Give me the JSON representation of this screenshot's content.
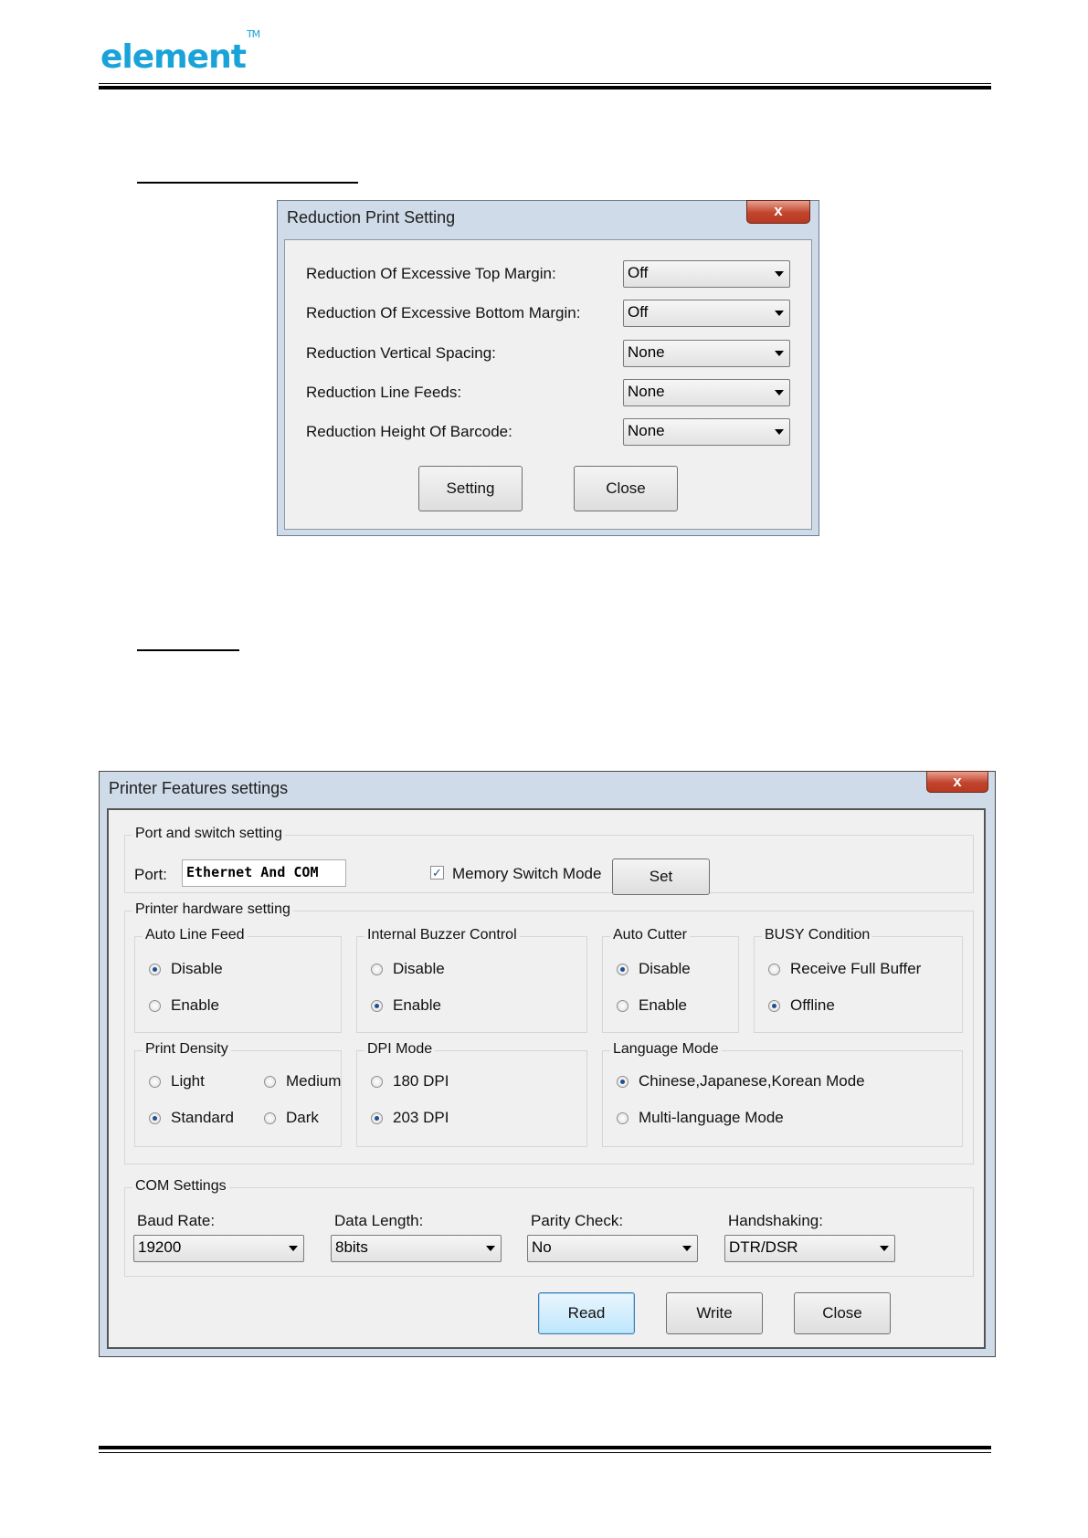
{
  "header": {
    "logo_text": "element",
    "logo_tm": "TM"
  },
  "reduction_dialog": {
    "title": "Reduction Print Setting",
    "close_glyph": "x",
    "rows": [
      {
        "label": "Reduction Of Excessive Top Margin:",
        "value": "Off"
      },
      {
        "label": "Reduction Of Excessive Bottom Margin:",
        "value": "Off"
      },
      {
        "label": "Reduction Vertical Spacing:",
        "value": "None"
      },
      {
        "label": "Reduction Line Feeds:",
        "value": "None"
      },
      {
        "label": "Reduction Height Of Barcode:",
        "value": "None"
      }
    ],
    "setting_button": "Setting",
    "close_button": "Close"
  },
  "features_dialog": {
    "title": "Printer Features settings",
    "close_glyph": "x",
    "port_group": {
      "label": "Port and switch setting",
      "port_label": "Port:",
      "port_value": "Ethernet And COM",
      "memory_switch_label": "Memory Switch Mode",
      "memory_switch_checked": true,
      "check_glyph": "✓",
      "set_button": "Set"
    },
    "hardware_group": {
      "label": "Printer hardware setting",
      "auto_line_feed": {
        "label": "Auto Line Feed",
        "options": [
          "Disable",
          "Enable"
        ],
        "selected": "Disable"
      },
      "buzzer": {
        "label": "Internal Buzzer Control",
        "options": [
          "Disable",
          "Enable"
        ],
        "selected": "Enable"
      },
      "auto_cutter": {
        "label": "Auto Cutter",
        "options": [
          "Disable",
          "Enable"
        ],
        "selected": "Disable"
      },
      "busy": {
        "label": "BUSY Condition",
        "options": [
          "Receive Full Buffer",
          "Offline"
        ],
        "selected": "Offline"
      },
      "density": {
        "label": "Print Density",
        "options": [
          "Light",
          "Medium",
          "Standard",
          "Dark"
        ],
        "selected": "Standard"
      },
      "dpi": {
        "label": "DPI Mode",
        "options": [
          "180 DPI",
          "203 DPI"
        ],
        "selected": "203 DPI"
      },
      "language": {
        "label": "Language Mode",
        "options": [
          "Chinese,Japanese,Korean Mode",
          "Multi-language Mode"
        ],
        "selected": "Chinese,Japanese,Korean Mode"
      }
    },
    "com_group": {
      "label": "COM Settings",
      "baud": {
        "label": "Baud Rate:",
        "value": "19200"
      },
      "data_length": {
        "label": "Data Length:",
        "value": "8bits"
      },
      "parity": {
        "label": "Parity Check:",
        "value": "No"
      },
      "handshaking": {
        "label": "Handshaking:",
        "value": "DTR/DSR"
      }
    },
    "read_button": "Read",
    "write_button": "Write",
    "close_button": "Close"
  }
}
